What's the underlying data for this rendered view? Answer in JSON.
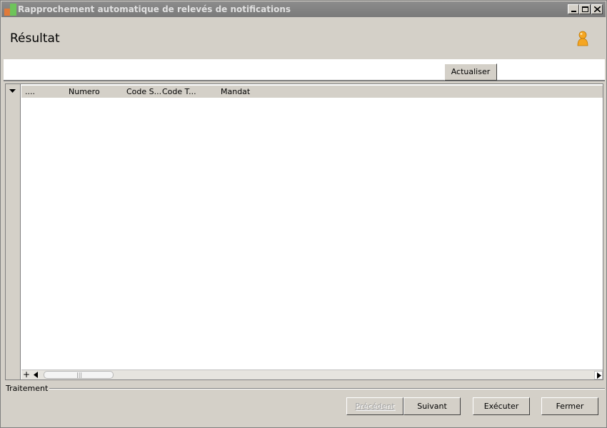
{
  "window": {
    "title": "Rapprochement automatique de relevés de notifications"
  },
  "header": {
    "title": "Résultat"
  },
  "toolbar": {
    "refresh_label": "Actualiser"
  },
  "grid": {
    "columns": [
      "....",
      "Numero",
      "Code S...",
      "Code T...",
      "Mandat"
    ],
    "rows": []
  },
  "footer": {
    "group_label": "Traitement",
    "prev_label": "Précédent",
    "next_label": "Suivant",
    "execute_label": "Exécuter",
    "close_label": "Fermer"
  },
  "icons": {
    "app": "app-icon",
    "user": "user-icon",
    "minimize": "minimize-icon",
    "maximize": "maximize-icon",
    "close": "close-icon"
  },
  "colors": {
    "titlebar": "#7a7a7a",
    "window_bg": "#d4d0c8",
    "user_icon": "#f5a623"
  }
}
